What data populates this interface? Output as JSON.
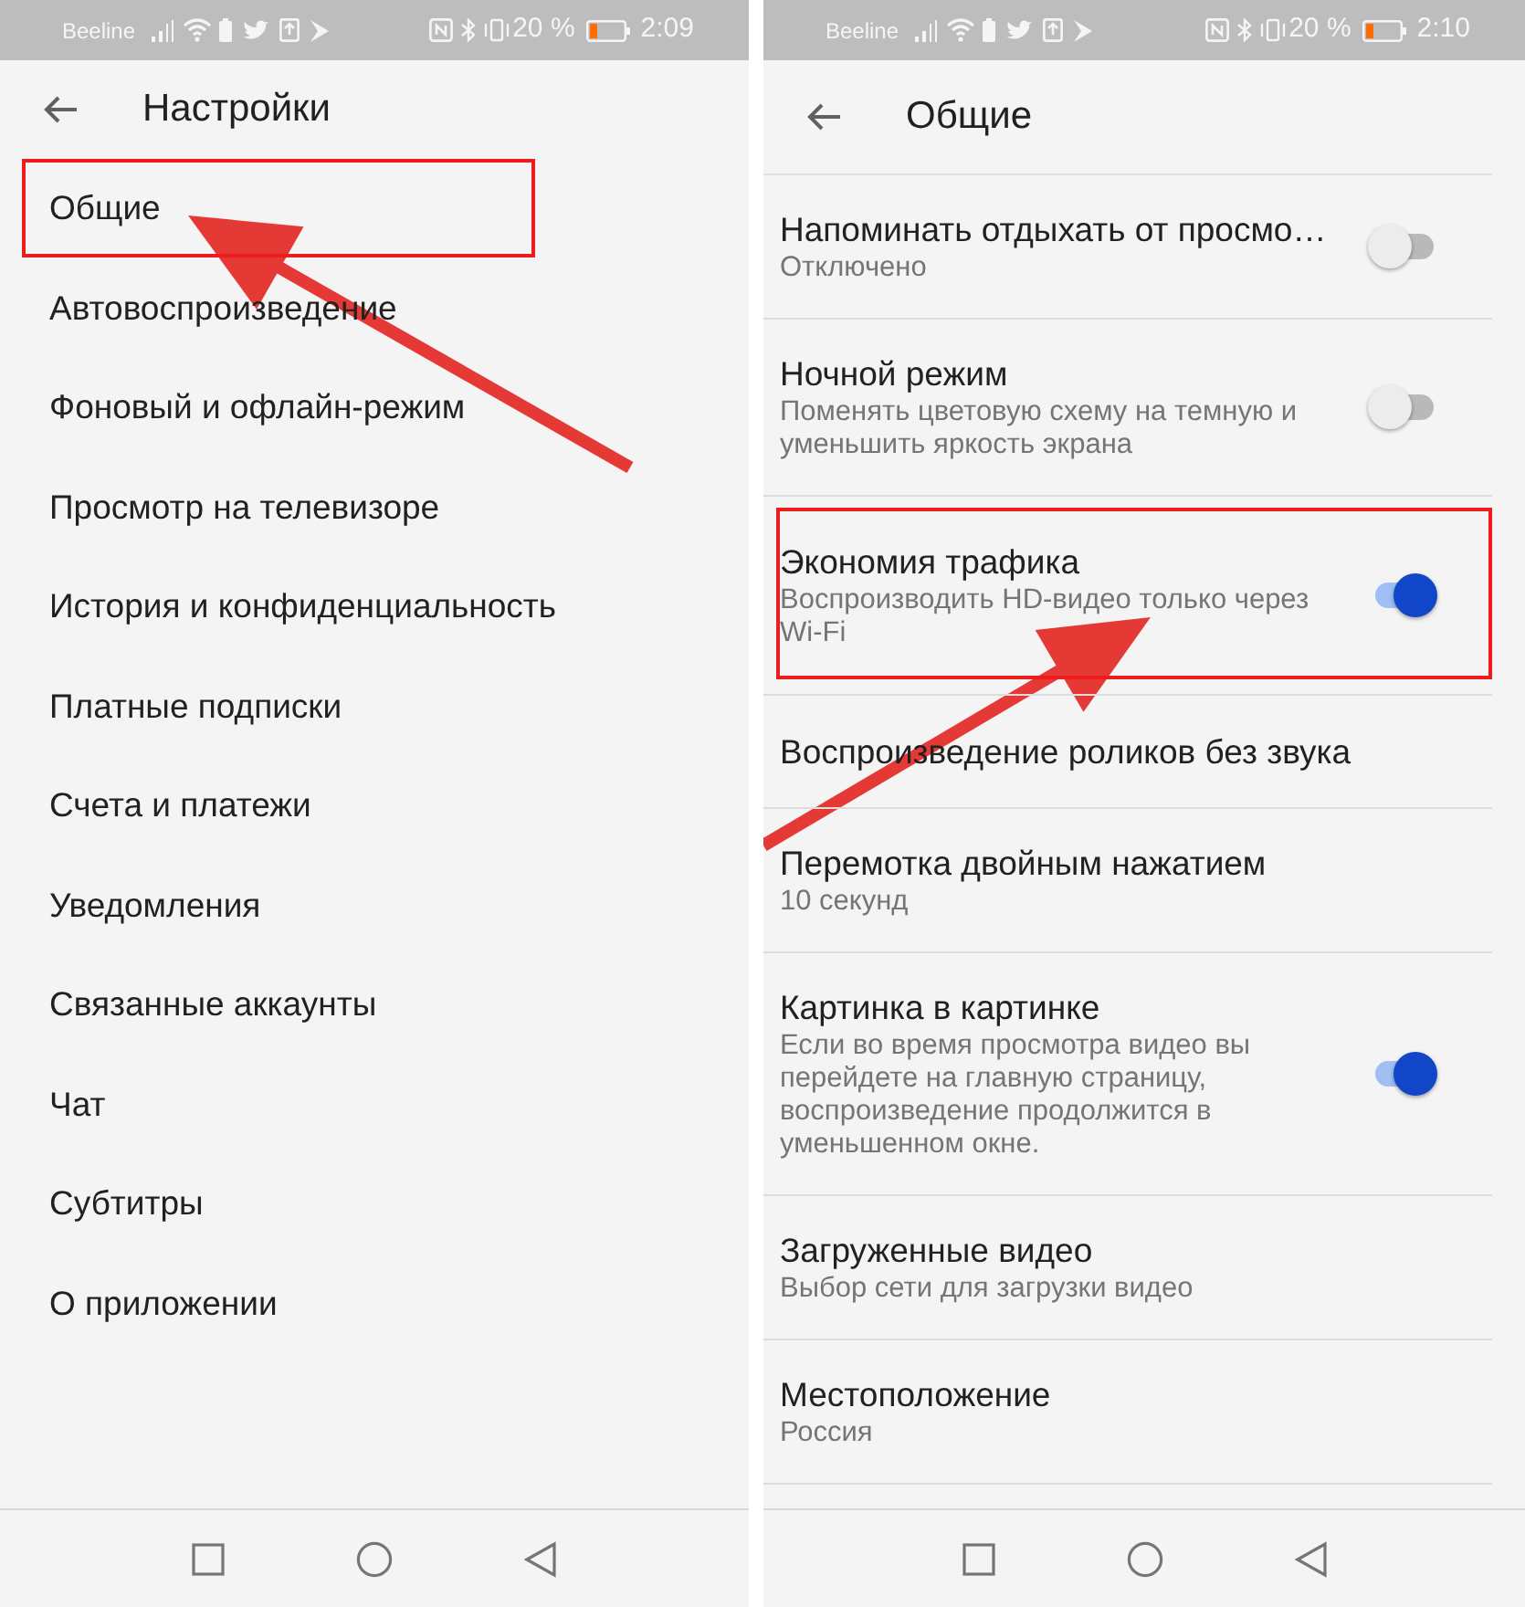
{
  "screens": [
    {
      "status_bar": {
        "carrier": "Beeline",
        "battery_percent": "20 %",
        "time": "2:09"
      },
      "title": "Настройки",
      "items": [
        {
          "label": "Общие",
          "highlighted": true
        },
        {
          "label": "Автовоспроизведение",
          "highlighted": false
        },
        {
          "label": "Фоновый и офлайн-режим",
          "highlighted": false
        },
        {
          "label": "Просмотр на телевизоре",
          "highlighted": false
        },
        {
          "label": "История и конфиденциальность",
          "highlighted": false
        },
        {
          "label": "Платные подписки",
          "highlighted": false
        },
        {
          "label": "Счета и платежи",
          "highlighted": false
        },
        {
          "label": "Уведомления",
          "highlighted": false
        },
        {
          "label": "Связанные аккаунты",
          "highlighted": false
        },
        {
          "label": "Чат",
          "highlighted": false
        },
        {
          "label": "Субтитры",
          "highlighted": false
        },
        {
          "label": "О приложении",
          "highlighted": false
        }
      ]
    },
    {
      "status_bar": {
        "carrier": "Beeline",
        "battery_percent": "20 %",
        "time": "2:10"
      },
      "title": "Общие",
      "items": [
        {
          "kind": "toggle",
          "label": "Напоминать отдыхать от просмо…",
          "subtitle": "Отключено",
          "on": false,
          "highlighted": false
        },
        {
          "kind": "toggle",
          "label": "Ночной режим",
          "subtitle": "Поменять цветовую схему на темную и уменьшить яркость экрана",
          "on": false,
          "highlighted": false
        },
        {
          "kind": "toggle",
          "label": "Экономия трафика",
          "subtitle": "Воспроизводить HD-видео только через Wi-Fi",
          "on": true,
          "highlighted": true
        },
        {
          "kind": "text",
          "label": "Воспроизведение роликов без звука",
          "highlighted": false
        },
        {
          "kind": "text",
          "label": "Перемотка двойным нажатием",
          "subtitle": "10 секунд",
          "highlighted": false
        },
        {
          "kind": "toggle",
          "label": "Картинка в картинке",
          "subtitle": "Если во время просмотра видео вы перейдете на главную страницу, воспроизведение продолжится в уменьшенном окне.",
          "on": true,
          "highlighted": false
        },
        {
          "kind": "text",
          "label": "Загруженные видео",
          "subtitle": "Выбор сети для загрузки видео",
          "highlighted": false
        },
        {
          "kind": "text",
          "label": "Местоположение",
          "subtitle": "Россия",
          "highlighted": false
        }
      ]
    }
  ]
}
